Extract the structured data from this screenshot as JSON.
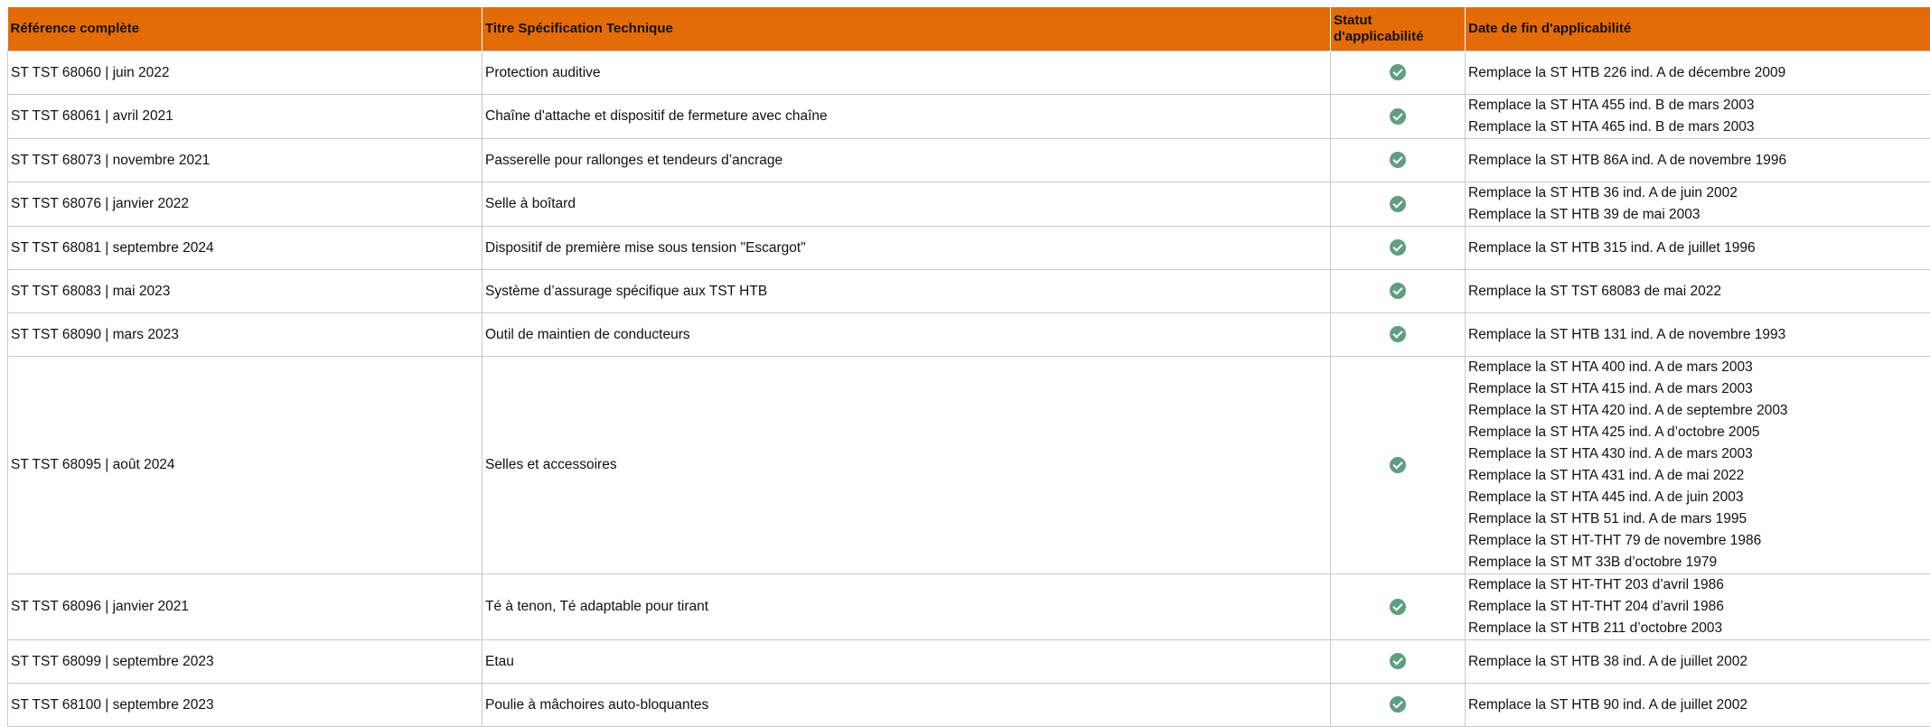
{
  "headers": {
    "reference": "Référence complète",
    "title": "Titre Spécification Technique",
    "status_line1": "Statut",
    "status_line2": "d'applicabilité",
    "end_date": "Date de fin d'applicabilité"
  },
  "status_icon": "check-circle-icon",
  "colors": {
    "header_bg": "#e36c09",
    "check": "#5f9e7f",
    "grid": "#c9c9c9"
  },
  "rows": [
    {
      "reference": "ST TST 68060 | juin 2022",
      "title": "Protection auditive",
      "replaces": [
        "Remplace la ST HTB 226 ind. A de décembre 2009"
      ]
    },
    {
      "reference": "ST TST 68061 | avril 2021",
      "title": "Chaîne d'attache et dispositif de fermeture avec chaîne",
      "replaces": [
        "Remplace la ST HTA 455 ind. B de mars 2003",
        "Remplace la ST HTA 465 ind. B de mars 2003"
      ]
    },
    {
      "reference": "ST TST 68073 | novembre 2021",
      "title": "Passerelle pour rallonges et tendeurs d’ancrage",
      "replaces": [
        "Remplace la ST HTB 86A ind. A de novembre 1996"
      ]
    },
    {
      "reference": "ST TST 68076 | janvier 2022",
      "title": "Selle à boîtard",
      "replaces": [
        "Remplace la ST HTB 36 ind. A de juin 2002",
        "Remplace la ST HTB 39 de mai 2003"
      ]
    },
    {
      "reference": "ST TST 68081 | septembre 2024",
      "title": "Dispositif de première mise sous tension \"Escargot\"",
      "replaces": [
        "Remplace la ST HTB 315 ind. A de juillet 1996"
      ]
    },
    {
      "reference": "ST TST 68083 | mai 2023",
      "title": "Système d’assurage spécifique aux TST HTB",
      "replaces": [
        "Remplace la ST TST 68083 de mai 2022"
      ]
    },
    {
      "reference": "ST TST 68090 | mars 2023",
      "title": "Outil de maintien de conducteurs",
      "replaces": [
        "Remplace la ST HTB 131 ind. A de novembre 1993"
      ]
    },
    {
      "reference": "ST TST 68095 | août 2024",
      "title": "Selles et accessoires",
      "replaces": [
        "Remplace la ST HTA 400 ind. A de mars 2003",
        "Remplace la ST HTA 415 ind. A de mars 2003",
        "Remplace la ST HTA 420 ind. A de septembre 2003",
        "Remplace la ST HTA 425 ind. A d’octobre 2005",
        "Remplace la ST HTA 430 ind. A de mars 2003",
        "Remplace la ST HTA 431 ind. A de mai 2022",
        "Remplace la ST HTA 445 ind. A de juin 2003",
        "Remplace la ST HTB 51 ind. A de mars 1995",
        "Remplace la ST HT-THT 79 de novembre 1986",
        "Remplace la ST MT 33B d’octobre 1979"
      ]
    },
    {
      "reference": "ST TST 68096 | janvier 2021",
      "title": "Té à tenon, Té adaptable pour tirant",
      "replaces": [
        "Remplace la ST HT-THT 203 d’avril 1986",
        "Remplace la ST HT-THT 204 d’avril 1986",
        "Remplace la ST HTB 211 d’octobre 2003"
      ]
    },
    {
      "reference": "ST TST 68099 | septembre 2023",
      "title": "Etau",
      "replaces": [
        "Remplace la ST HTB 38 ind. A de juillet 2002"
      ]
    },
    {
      "reference": "ST TST 68100 | septembre 2023",
      "title": "Poulie à mâchoires auto-bloquantes",
      "replaces": [
        "Remplace la ST HTB 90 ind. A de juillet 2002"
      ]
    }
  ]
}
